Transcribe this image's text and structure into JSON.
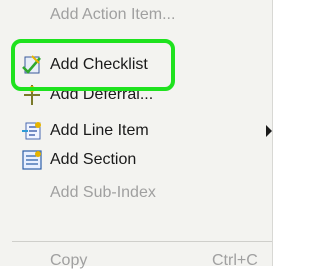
{
  "menu": {
    "items": [
      {
        "label": "Add Action Item...",
        "disabled": true,
        "icon": "none"
      },
      {
        "label": "Add Checklist",
        "disabled": false,
        "icon": "checklist-icon"
      },
      {
        "label": "Add Deferral...",
        "disabled": false,
        "icon": "deferral-icon"
      },
      {
        "label": "Add Line Item",
        "disabled": false,
        "icon": "line-item-icon",
        "has_submenu": true
      },
      {
        "label": "Add Section",
        "disabled": false,
        "icon": "section-icon"
      },
      {
        "label": "Add Sub-Index",
        "disabled": true,
        "icon": "none"
      },
      {
        "label": "Copy",
        "disabled": true,
        "icon": "none",
        "shortcut": "Ctrl+C"
      }
    ]
  },
  "colors": {
    "highlight": "#1ee21e",
    "menu_bg": "#f3f3f0"
  }
}
